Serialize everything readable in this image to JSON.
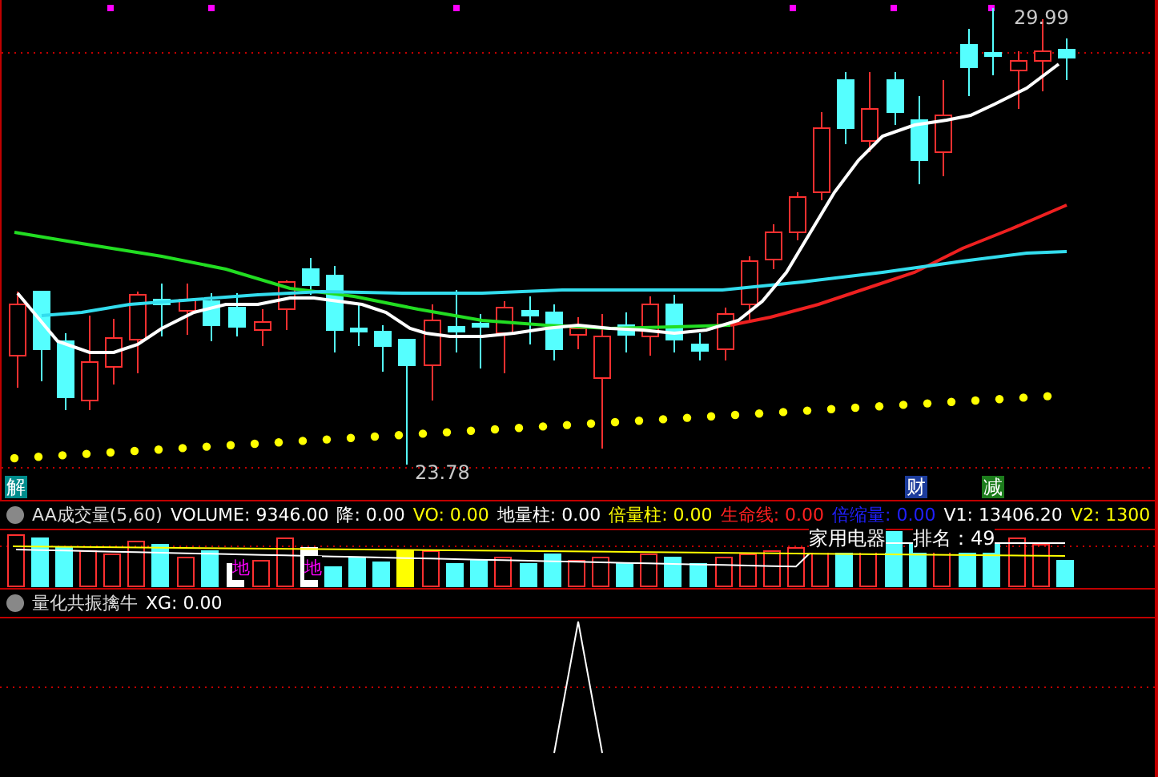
{
  "main_chart": {
    "high_label": "29.99",
    "low_label": "23.78",
    "markers": [
      {
        "text": "解",
        "color": "#008c8c"
      },
      {
        "text": "财",
        "color": "#1c3c9c"
      },
      {
        "text": "减",
        "color": "#1c7c1c"
      }
    ]
  },
  "volume_panel": {
    "title": "AA成交量(5,60)",
    "readouts": [
      {
        "label": "VOLUME:",
        "value": "9346.00",
        "color": "#ffffff"
      },
      {
        "label": "降:",
        "value": "0.00",
        "color": "#ffffff"
      },
      {
        "label": "VO:",
        "value": "0.00",
        "color": "#ffff00"
      },
      {
        "label": "地量柱:",
        "value": "0.00",
        "color": "#ffffff"
      },
      {
        "label": "倍量柱:",
        "value": "0.00",
        "color": "#ffff00"
      },
      {
        "label": "生命线:",
        "value": "0.00",
        "color": "#ff2020"
      },
      {
        "label": "倍缩量:",
        "value": "0.00",
        "color": "#2020ff"
      },
      {
        "label": "V1:",
        "value": "13406.20",
        "color": "#ffffff"
      },
      {
        "label": "V2:",
        "value": "1300",
        "color": "#ffff00"
      }
    ],
    "sector": "家用电器",
    "rank_label": "排名：",
    "rank": "49",
    "bar_labels": [
      "地",
      "地"
    ]
  },
  "xg_panel": {
    "title": "量化共振擒牛",
    "readouts": [
      {
        "label": "XG:",
        "value": "0.00",
        "color": "#ffffff"
      }
    ]
  }
}
